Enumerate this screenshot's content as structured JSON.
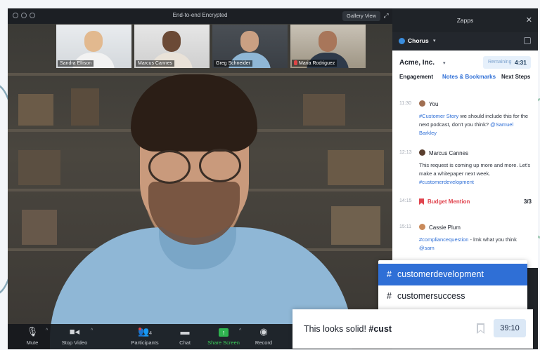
{
  "window": {
    "title": "End-to-end Encrypted",
    "gallery_view_label": "Gallery View"
  },
  "thumbnails": [
    {
      "name": "Sandra Ellison",
      "muted": false
    },
    {
      "name": "Marcus Cannes",
      "muted": false
    },
    {
      "name": "Greg Schneider",
      "muted": false,
      "active": true
    },
    {
      "name": "Maria Rodriguez",
      "muted": true
    }
  ],
  "toolbar": {
    "mute": "Mute",
    "stop_video": "Stop Video",
    "participants": "Participants",
    "participants_count": "4",
    "chat": "Chat",
    "share_screen": "Share Screen",
    "record": "Record"
  },
  "zapps": {
    "title": "Zapps",
    "app_name": "Chorus"
  },
  "panel": {
    "account": "Acme, Inc.",
    "remaining_label": "Remaining",
    "remaining_value": "4:31",
    "tabs": [
      "Engagement",
      "Notes & Bookmarks",
      "Next Steps"
    ],
    "entries": [
      {
        "time": "11:30",
        "author": "You",
        "tag1": "#Customer Story",
        "text1": " we should include this for the next podcast, don't you think? ",
        "mention": "@Samuel Barkley"
      },
      {
        "time": "12:13",
        "author": "Marcus Cannes",
        "text1": "This request is coming up more and more. Let's make a whitepaper next week. ",
        "tag1": "#customerdevelopment"
      },
      {
        "time": "14:15",
        "label": "Budget Mention",
        "count": "3/3"
      },
      {
        "time": "15:11",
        "author": "Cassie Plum",
        "tag1": "#compliancequestion",
        "text1": " - lmk what you think ",
        "mention": "@sam"
      }
    ]
  },
  "dropdown": {
    "options": [
      "customerdevelopment",
      "customersuccess"
    ],
    "selected": "customerdevelopment"
  },
  "composer": {
    "text_prefix": "This looks solid! ",
    "text_tag": "#cust",
    "timestamp": "39:10"
  },
  "colors": {
    "accent": "#2f6fd6",
    "active_speaker": "#3ccf5b",
    "alert": "#e0454f"
  }
}
